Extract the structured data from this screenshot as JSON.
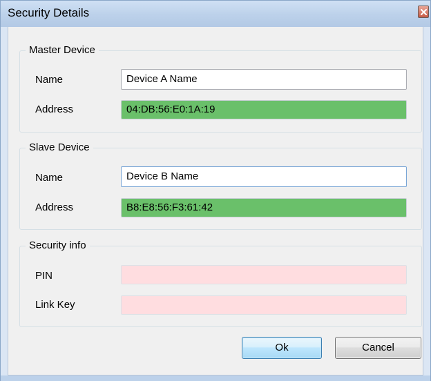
{
  "window": {
    "title": "Security Details"
  },
  "master_device": {
    "group_label": "Master Device",
    "name_label": "Name",
    "name_value": "Device A Name",
    "address_label": "Address",
    "address_value": "04:DB:56:E0:1A:19"
  },
  "slave_device": {
    "group_label": "Slave Device",
    "name_label": "Name",
    "name_value": "Device B Name",
    "address_label": "Address",
    "address_value": "B8:E8:56:F3:61:42"
  },
  "security_info": {
    "group_label": "Security info",
    "pin_label": "PIN",
    "pin_value": "",
    "link_key_label": "Link Key",
    "link_key_value": ""
  },
  "buttons": {
    "ok_label": "Ok",
    "cancel_label": "Cancel"
  },
  "colors": {
    "address_field_bg": "#6ac06a",
    "security_field_bg": "#ffdde0",
    "titlebar": "#bcd1ea",
    "close_button": "#c75b45"
  }
}
